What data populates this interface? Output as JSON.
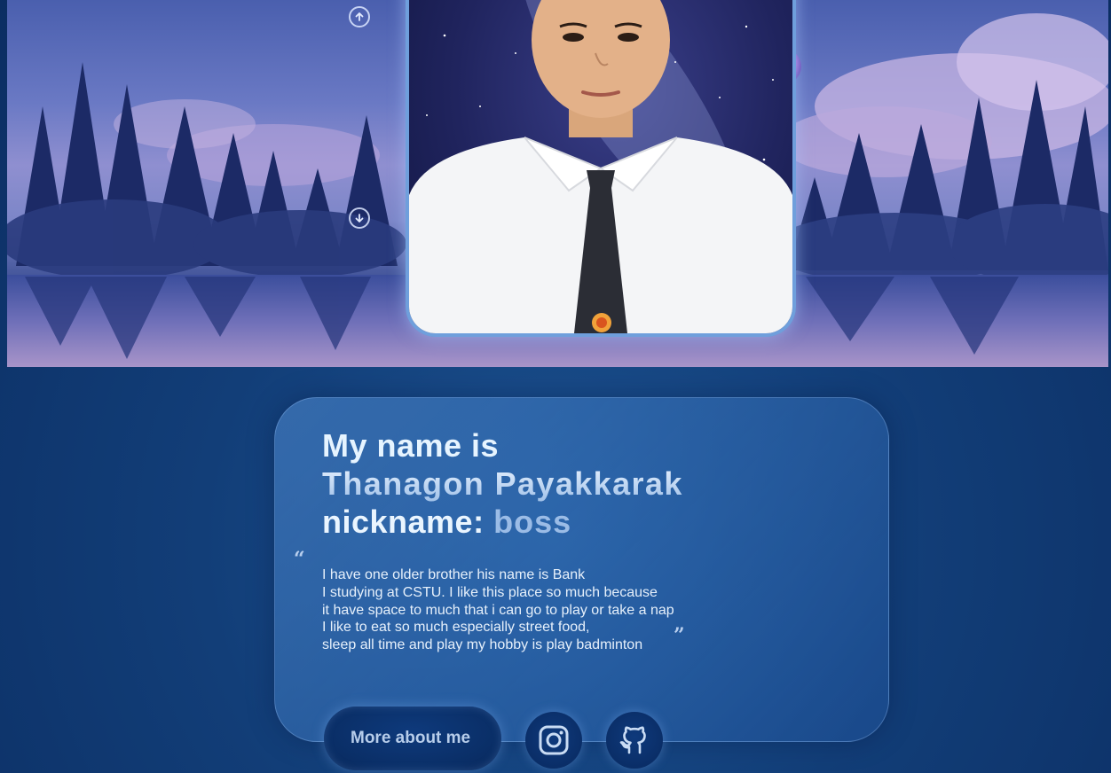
{
  "hero": {
    "scroll_up_icon": "arrow-up-circle-icon",
    "scroll_down_icon": "arrow-down-circle-icon"
  },
  "profile": {
    "greeting": "My name is",
    "full_name": "Thanagon Payakkarak",
    "nickname_label": "nickname:",
    "nickname": "boss"
  },
  "bio": {
    "lines": [
      "I have one older brother his name is Bank",
      "I studying at CSTU. I like this place so much because",
      "it have space to much that i can go to play or take a nap",
      "I like to eat so much especially street food,",
      "sleep all time and play my hobby is play badminton"
    ],
    "open_quote": "“",
    "close_quote": "”"
  },
  "actions": {
    "more_label": "More about me",
    "instagram_icon": "instagram-icon",
    "github_icon": "github-icon"
  },
  "colors": {
    "page_bg": "#123e78",
    "card_border": "#6f9fdc",
    "accent_text": "#9bbce6"
  }
}
